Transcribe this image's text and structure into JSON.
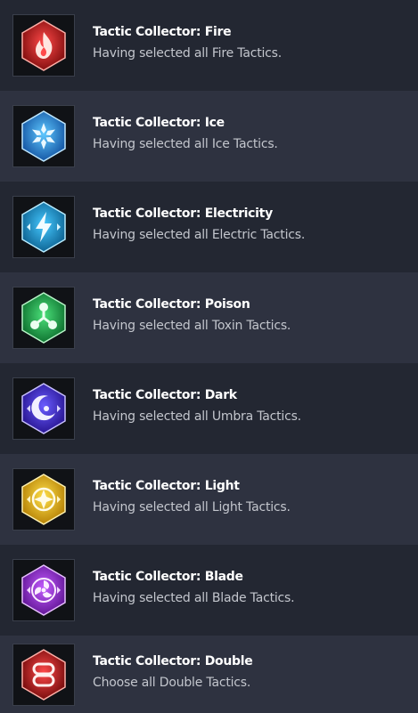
{
  "achievements": [
    {
      "title": "Tactic Collector: Fire",
      "description": "Having selected all Fire Tactics.",
      "icon": "fire-icon",
      "colors": {
        "light": "#ff4a4a",
        "dark": "#7a0a0a"
      }
    },
    {
      "title": "Tactic Collector: Ice",
      "description": "Having selected all Ice Tactics.",
      "icon": "snowflake-icon",
      "colors": {
        "light": "#5fc8ff",
        "dark": "#0f4e9e"
      }
    },
    {
      "title": "Tactic Collector: Electricity",
      "description": "Having selected all Electric Tactics.",
      "icon": "lightning-icon",
      "colors": {
        "light": "#45c8ff",
        "dark": "#0a5d8c"
      }
    },
    {
      "title": "Tactic Collector: Poison",
      "description": "Having selected all Toxin Tactics.",
      "icon": "toxin-icon",
      "colors": {
        "light": "#4be07a",
        "dark": "#0a6a2a"
      }
    },
    {
      "title": "Tactic Collector: Dark",
      "description": "Having selected all Umbra Tactics.",
      "icon": "crescent-moon-icon",
      "colors": {
        "light": "#6a5cff",
        "dark": "#23108a"
      }
    },
    {
      "title": "Tactic Collector: Light",
      "description": "Having selected all Light Tactics.",
      "icon": "sun-icon",
      "colors": {
        "light": "#ffe04a",
        "dark": "#b07a00"
      }
    },
    {
      "title": "Tactic Collector: Blade",
      "description": "Having selected all Blade Tactics.",
      "icon": "blade-swirl-icon",
      "colors": {
        "light": "#c45cff",
        "dark": "#5b118f"
      }
    },
    {
      "title": "Tactic Collector: Double",
      "description": "Choose all Double Tactics.",
      "icon": "double-chain-icon",
      "colors": {
        "light": "#ff4a4a",
        "dark": "#6e0808"
      }
    }
  ]
}
